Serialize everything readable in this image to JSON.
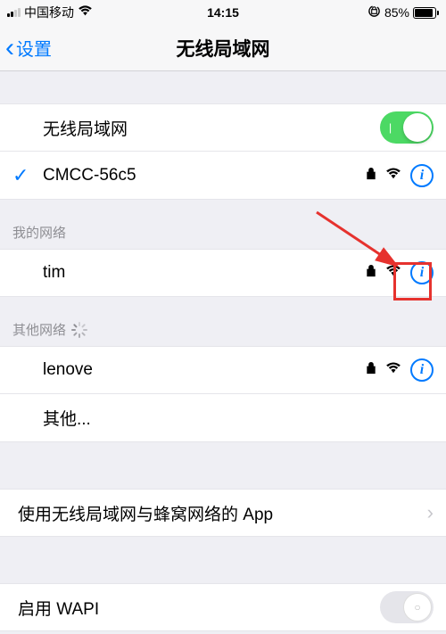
{
  "statusBar": {
    "carrier": "中国移动",
    "time": "14:15",
    "batteryPercent": "85%"
  },
  "nav": {
    "back": "设置",
    "title": "无线局域网"
  },
  "main": {
    "wifiToggleLabel": "无线局域网",
    "wifiOn": true,
    "connectedNetwork": "CMCC-56c5"
  },
  "sections": {
    "myNetworksHeader": "我的网络",
    "myNetworks": [
      {
        "name": "tim",
        "locked": true
      }
    ],
    "otherNetworksHeader": "其他网络",
    "otherNetworks": [
      {
        "name": "lenove",
        "locked": true
      }
    ],
    "otherLabel": "其他..."
  },
  "footer": {
    "appsUsingWlan": "使用无线局域网与蜂窝网络的 App",
    "enableWapi": "启用 WAPI"
  }
}
